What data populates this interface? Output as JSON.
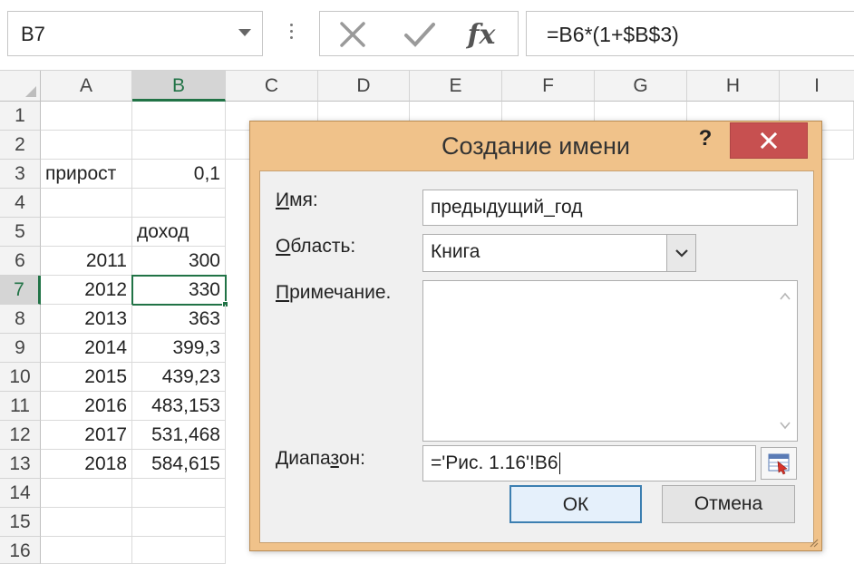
{
  "formula_bar": {
    "name_box": "B7",
    "formula": "=B6*(1+$B$3)",
    "fx_label": "fx"
  },
  "columns": [
    "A",
    "B",
    "C",
    "D",
    "E",
    "F",
    "G",
    "H",
    "I"
  ],
  "rows": [
    "1",
    "2",
    "3",
    "4",
    "5",
    "6",
    "7",
    "8",
    "9",
    "10",
    "11",
    "12",
    "13",
    "14",
    "15",
    "16"
  ],
  "cells": {
    "A3": "прирост",
    "B3": "0,1",
    "B5": "доход",
    "A6": "2011",
    "B6": "300",
    "A7": "2012",
    "B7": "330",
    "A8": "2013",
    "B8": "363",
    "A9": "2014",
    "B9": "399,3",
    "A10": "2015",
    "B10": "439,23",
    "A11": "2016",
    "B11": "483,153",
    "A12": "2017",
    "B12": "531,468",
    "A13": "2018",
    "B13": "584,615"
  },
  "dialog": {
    "title": "Создание имени",
    "help": "?",
    "name_label_u": "И",
    "name_label_rest": "мя:",
    "name_value": "предыдущий_год",
    "scope_label_u": "О",
    "scope_label_rest": "бласть:",
    "scope_value": "Книга",
    "comment_label_u": "П",
    "comment_label_rest": "римечание.",
    "comment_value": "",
    "range_label_pre": "Диапа",
    "range_label_u": "з",
    "range_label_rest": "он:",
    "range_value": "='Рис. 1.16'!B6",
    "ok_label": "ОК",
    "cancel_label": "Отмена"
  },
  "colors": {
    "accent_green": "#217346",
    "dialog_frame": "#f0c28a",
    "close_red": "#c75050",
    "ok_border": "#3c7fb1"
  }
}
